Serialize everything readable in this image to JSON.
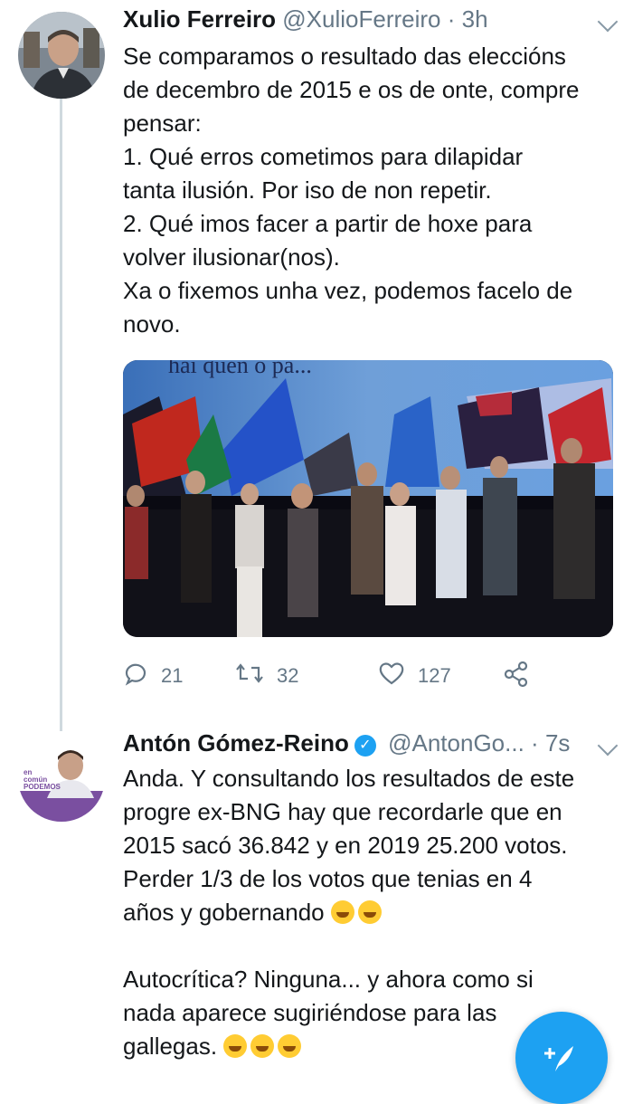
{
  "tweet1": {
    "display_name": "Xulio Ferreiro",
    "handle": "@XulioFerreiro",
    "separator": "·",
    "time": "3h",
    "text": "Se comparamos o resultado das eleccións\nde decembro de 2015 e os de onte, compre\npensar:\n1. Qué erros cometimos para dilapidar\ntanta ilusión. Por iso de non repetir.\n2. Qué imos facer a partir de hoxe para\nvolver ilusionar(nos).\nXa o fixemos unha vez, podemos facelo de\nnovo.",
    "media_banner": "hai quen o pa...",
    "replies": "21",
    "retweets": "32",
    "likes": "127"
  },
  "tweet2": {
    "display_name": "Antón Gómez-Reino",
    "handle": "@AntonGo...",
    "separator": "·",
    "time": "7s",
    "text_line1": "Anda. Y consultando los resultados de este",
    "text_line2": "progre ex-BNG hay que recordarle que en",
    "text_line3": "2015 sacó 36.842 y en 2019 25.200 votos.",
    "text_line4": "Perder 1/3 de los votos que tenias en 4",
    "text_line5": "años y gobernando",
    "text_line6": "Autocrítica? Ninguna... y ahora como si",
    "text_line7": "nada aparece sugiriéndose para las",
    "text_line8": "gallegas.",
    "avatar_badge_line1": "en",
    "avatar_badge_line2": "común",
    "avatar_badge_line3": "PODEMOS"
  },
  "icons": {
    "reply": "reply-icon",
    "retweet": "retweet-icon",
    "like": "heart-icon",
    "share": "share-icon",
    "compose": "compose-tweet-icon",
    "verified": "verified-badge-icon"
  },
  "colors": {
    "accent": "#1da1f2",
    "secondary_text": "#657786"
  }
}
